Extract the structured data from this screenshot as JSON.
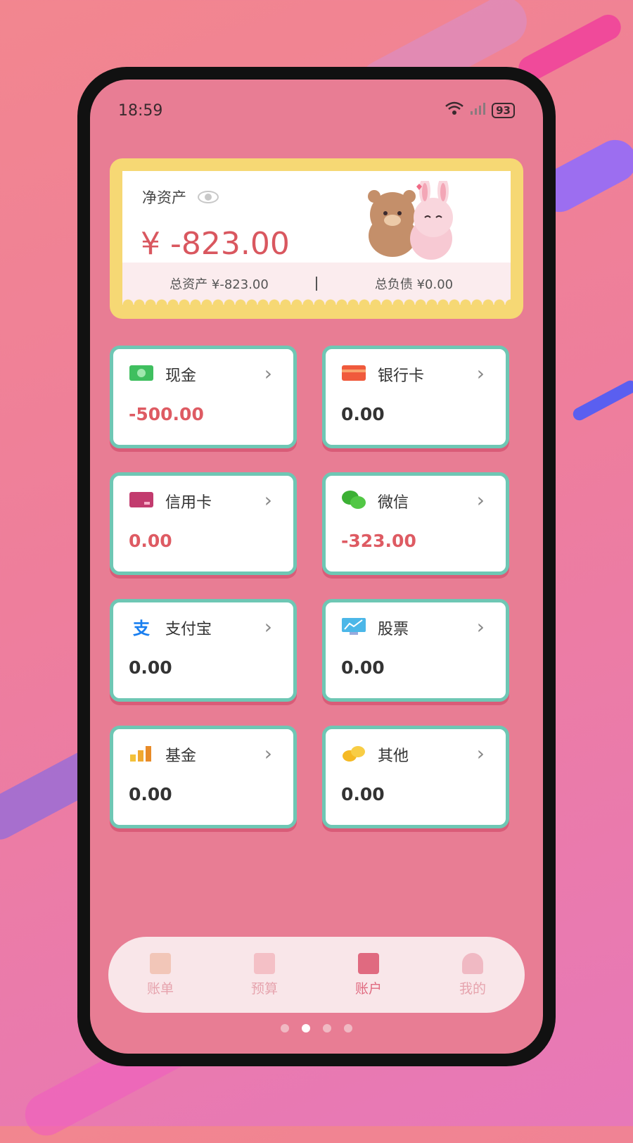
{
  "status": {
    "time": "18:59",
    "battery": "93"
  },
  "net_assets": {
    "title": "净资产",
    "amount": "¥ -823.00",
    "total_assets": "总资产 ¥-823.00",
    "total_liabilities": "总负债 ¥0.00"
  },
  "accounts": [
    {
      "label": "现金",
      "value": "-500.00",
      "icon": "cash-icon",
      "negative": true
    },
    {
      "label": "银行卡",
      "value": "0.00",
      "icon": "bank-card-icon",
      "negative": false
    },
    {
      "label": "信用卡",
      "value": "0.00",
      "icon": "credit-card-icon",
      "negative": true
    },
    {
      "label": "微信",
      "value": "-323.00",
      "icon": "wechat-icon",
      "negative": true
    },
    {
      "label": "支付宝",
      "value": "0.00",
      "icon": "alipay-icon",
      "negative": false
    },
    {
      "label": "股票",
      "value": "0.00",
      "icon": "stock-icon",
      "negative": false
    },
    {
      "label": "基金",
      "value": "0.00",
      "icon": "fund-icon",
      "negative": false
    },
    {
      "label": "其他",
      "value": "0.00",
      "icon": "coins-icon",
      "negative": false
    }
  ],
  "tabs": [
    {
      "label": "账单",
      "icon": "bill-icon"
    },
    {
      "label": "预算",
      "icon": "budget-icon"
    },
    {
      "label": "账户",
      "icon": "account-icon",
      "active": true
    },
    {
      "label": "我的",
      "icon": "profile-icon"
    }
  ],
  "colors": {
    "accent": "#e87d94",
    "card_border": "#6ec7b4",
    "negative": "#de5b63"
  }
}
